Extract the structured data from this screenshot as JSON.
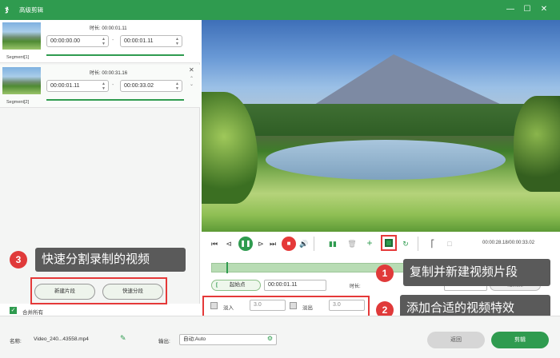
{
  "window": {
    "title": "高级剪辑",
    "app_logo": "ჯ"
  },
  "segments": [
    {
      "label": "Segment[1]",
      "duration_label": "时长:",
      "duration": "00:00:01.11",
      "start": "00:00:00.00",
      "end": "00:00:01.11",
      "progress": 1.0
    },
    {
      "label": "Segment[2]",
      "duration_label": "时长:",
      "duration": "00:00:31.16",
      "start": "00:00:01.11",
      "end": "00:00:33.02",
      "progress": 1.0
    }
  ],
  "annotations": {
    "a1": {
      "number": "1",
      "text": "复制并新建视频片段"
    },
    "a2": {
      "number": "2",
      "text": "添加合适的视频特效"
    },
    "a3": {
      "number": "3",
      "text": "快速分割录制的视频"
    }
  },
  "left_buttons": {
    "new_segment": "新建片段",
    "quick_split": "快速分段"
  },
  "merge_all": {
    "label": "合并所有",
    "checked": true
  },
  "player": {
    "time": "00:00:28.18/00:00:33.02"
  },
  "range": {
    "start_label": "起始点",
    "start_value": "00:00:01.11",
    "duration_label": "时长:",
    "end_value": "00:00:33.02",
    "end_label": "结束点"
  },
  "effects": {
    "fade_in_label": "淡入",
    "fade_in_value": "3.0",
    "fade_out_label": "淡出",
    "fade_out_value": "3.0"
  },
  "bottom": {
    "name_label": "名称:",
    "name_value": "Video_240...43558.mp4",
    "output_label": "输出:",
    "output_value": "自动;Auto",
    "back_label": "返回",
    "edit_label": "剪辑"
  },
  "colors": {
    "accent": "#2f9b4f",
    "annotation_red": "#e53939",
    "bubble_bg": "#5a5a5a"
  }
}
